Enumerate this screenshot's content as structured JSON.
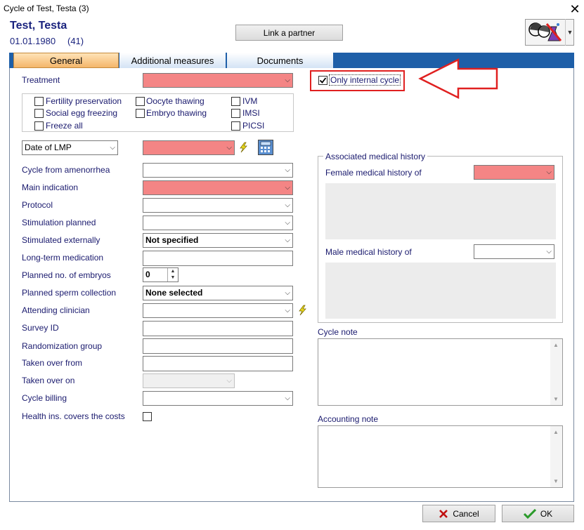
{
  "window": {
    "title": "Cycle of Test, Testa (3)",
    "close_glyph": "✕"
  },
  "patient": {
    "name": "Test, Testa",
    "dob": "01.01.1980",
    "cycle_no": "(41)"
  },
  "header": {
    "link_partner_label": "Link a partner"
  },
  "tabs": [
    {
      "label": "General"
    },
    {
      "label": "Additional measures"
    },
    {
      "label": "Documents"
    }
  ],
  "left": {
    "treatment_label": "Treatment",
    "checkboxes": {
      "fertility_preservation": "Fertility preservation",
      "oocyte_thawing": "Oocyte thawing",
      "ivm": "IVM",
      "social_egg_freezing": "Social egg freezing",
      "embryo_thawing": "Embryo thawing",
      "imsi": "IMSI",
      "freeze_all": "Freeze all",
      "picsi": "PICSI"
    },
    "date_type_value": "Date of LMP",
    "fields": {
      "cycle_from_amenorrhea": "Cycle from amenorrhea",
      "main_indication": "Main indication",
      "protocol": "Protocol",
      "stimulation_planned": "Stimulation planned",
      "stimulated_externally": "Stimulated externally",
      "long_term_medication": "Long-term medication",
      "planned_embryos": "Planned no. of embryos",
      "planned_sperm": "Planned sperm collection",
      "attending_clinician": "Attending clinician",
      "survey_id": "Survey ID",
      "randomization_group": "Randomization group",
      "taken_over_from": "Taken over from",
      "taken_over_on": "Taken over on",
      "cycle_billing": "Cycle billing",
      "health_ins": "Health ins. covers the costs"
    },
    "values": {
      "stimulated_externally": "Not specified",
      "planned_embryos": "0",
      "planned_sperm": "None selected"
    }
  },
  "right": {
    "only_internal_cycle": "Only internal cycle",
    "assoc_legend": "Associated medical history",
    "female_history": "Female medical history of",
    "male_history": "Male medical history of",
    "cycle_note": "Cycle note",
    "accounting_note": "Accounting note"
  },
  "footer": {
    "cancel_label": "Cancel",
    "ok_label": "OK"
  },
  "colors": {
    "required": "#f48585",
    "tab_active": "#f4b66a",
    "tabbar": "#1e5fa8",
    "annotation_arrow": "#e02020"
  }
}
